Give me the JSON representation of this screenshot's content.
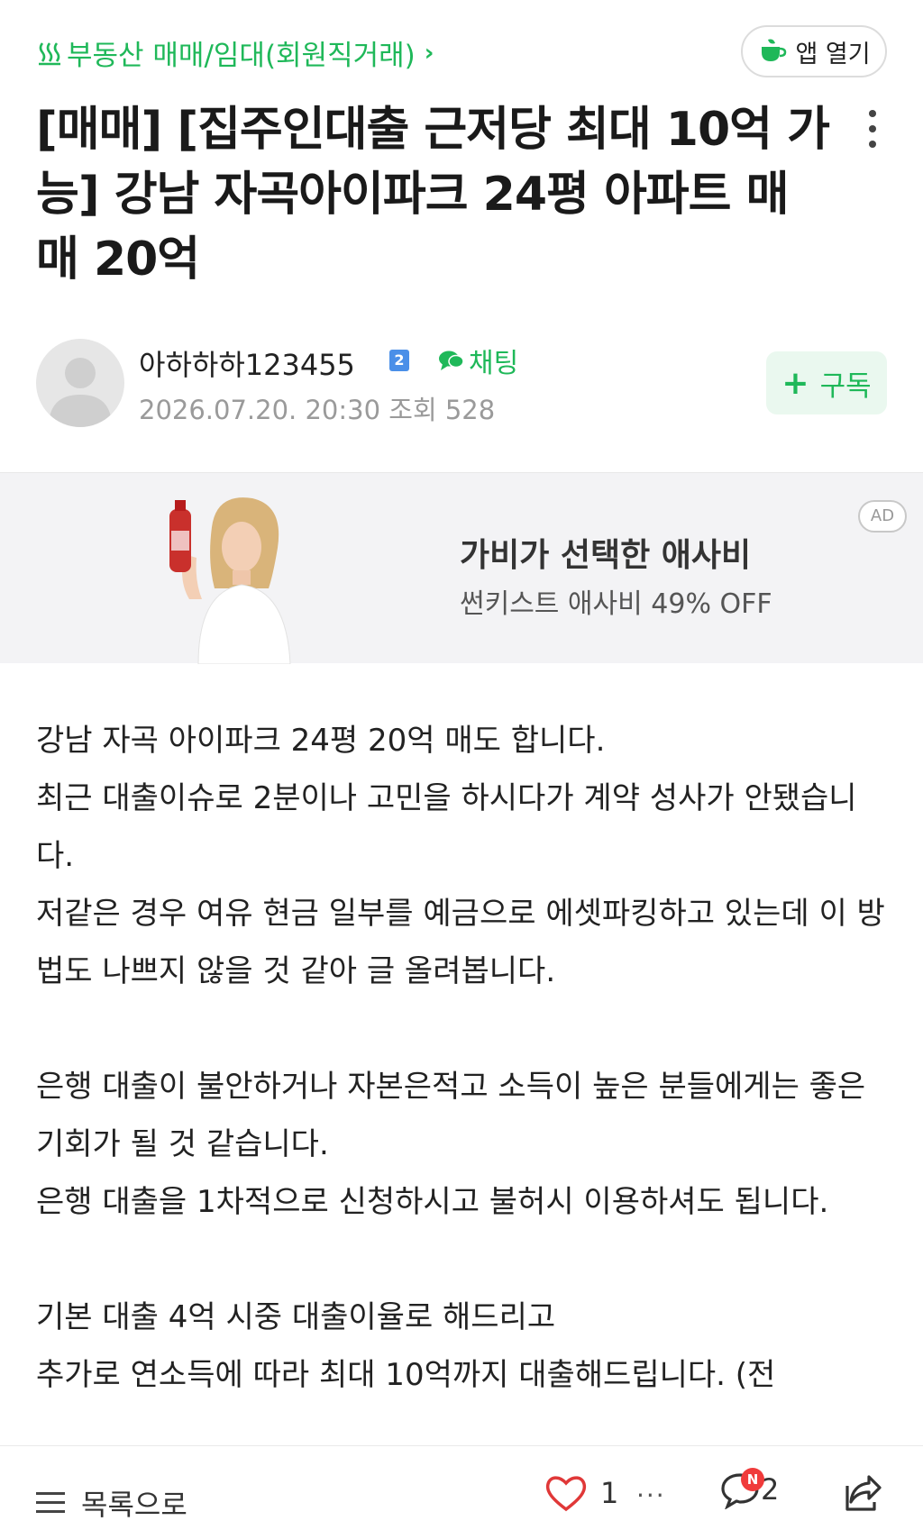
{
  "header": {
    "breadcrumb": "부동산 매매/임대(회원직거래)",
    "app_open_label": "앱 열기"
  },
  "post": {
    "title": "[매매] [집주인대출 근저당 최대 10억 가능] 강남 자곡아이파크 24평 아파트 매매 20억",
    "author": "아하하하123455",
    "level_badge": "2",
    "chat_label": "채팅",
    "datetime": "2026.07.20. 20:30",
    "views_label": "조회 528",
    "subscribe_label": "구독"
  },
  "ad": {
    "title": "가비가 선택한 애사비",
    "subtitle": "썬키스트 애사비 49% OFF",
    "badge": "AD"
  },
  "content": {
    "paragraphs": [
      "강남 자곡 아이파크 24평 20억 매도 합니다.",
      "최근 대출이슈로 2분이나 고민을 하시다가 계약 성사가 안됐습니다.",
      "저같은 경우 여유 현금 일부를 예금으로 에셋파킹하고 있는데 이 방법도 나쁘지 않을 것 같아 글 올려봅니다.",
      "",
      "은행 대출이 불안하거나 자본은적고 소득이 높은 분들에게는 좋은 기회가 될 것 같습니다.",
      "은행 대출을 1차적으로 신청하시고 불허시 이용하셔도 됩니다.",
      "",
      "기본 대출 4억 시중 대출이율로 해드리고",
      "추가로 연소득에 따라 최대 10억까지 대출해드립니다. (전"
    ]
  },
  "bottom_bar": {
    "list_label": "목록으로",
    "like_count": "1",
    "more_label": "···",
    "comment_count": "2",
    "comment_badge": "N"
  },
  "colors": {
    "brand_green": "#1fb859",
    "badge_red": "#f03b3b",
    "level_blue": "#4a8fe8"
  }
}
